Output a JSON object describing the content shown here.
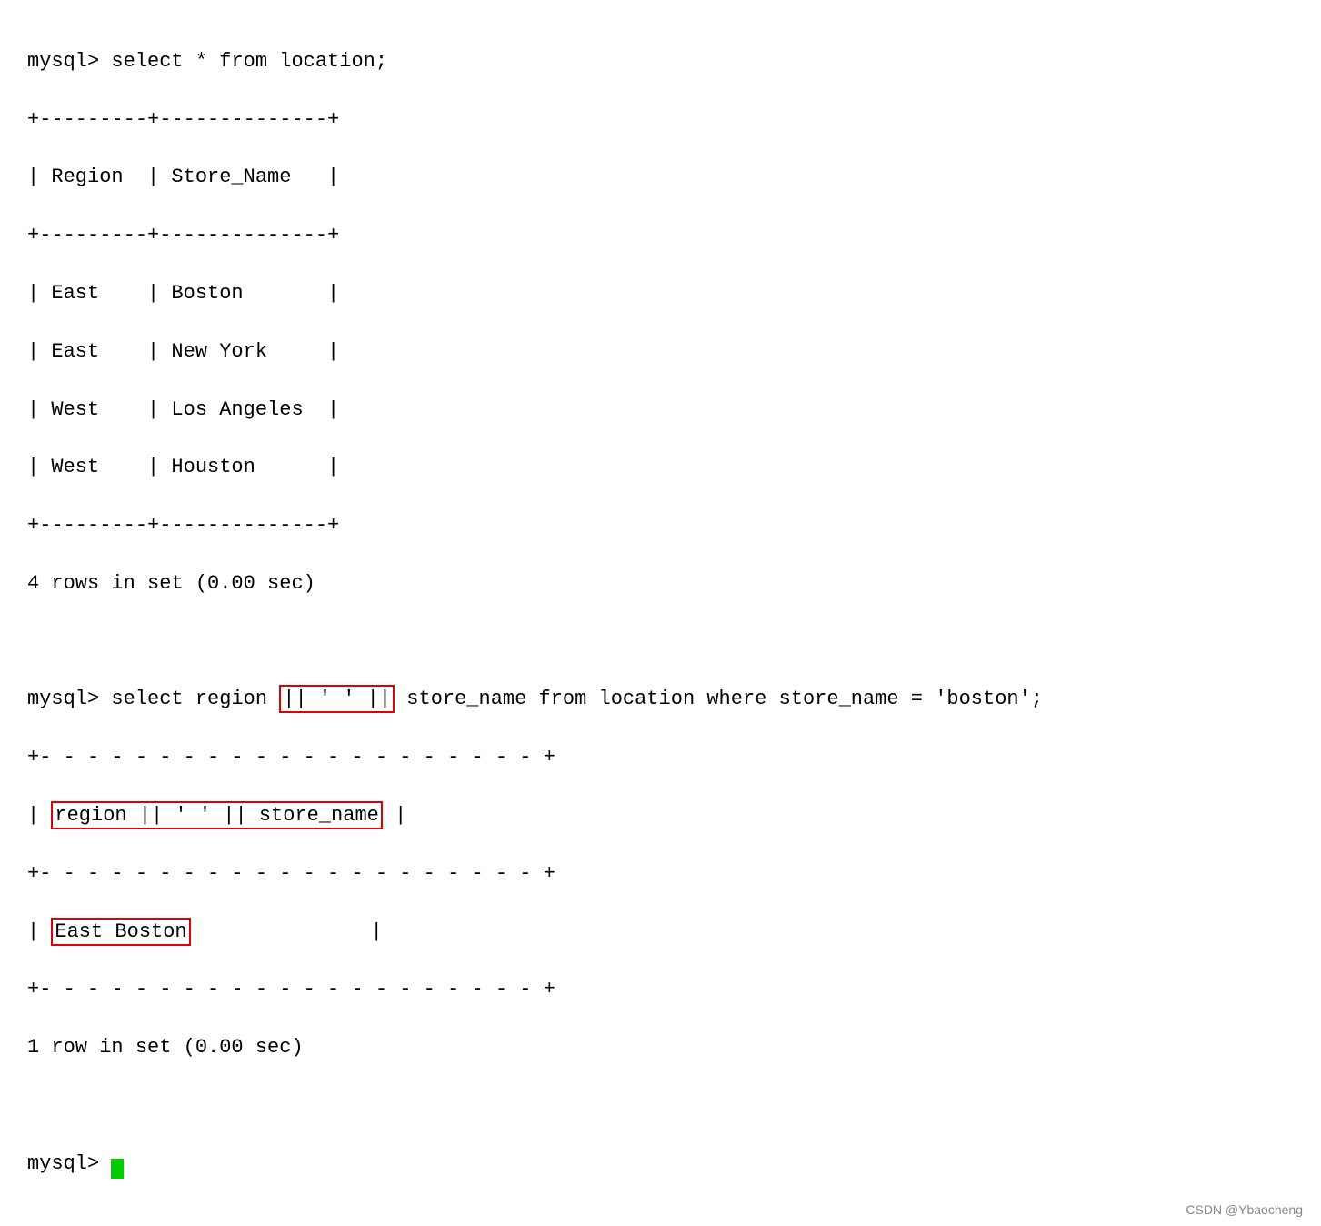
{
  "terminal": {
    "prompt": "mysql>",
    "query1": "select * from location;",
    "table1": {
      "border_top": "+---------+--------------+",
      "header": "| Region  | Store_Name   |",
      "border_mid": "+---------+--------------+",
      "rows": [
        "| East    | Boston       |",
        "| East    | New York     |",
        "| West    | Los Angeles  |",
        "| West    | Houston      |"
      ],
      "border_bot": "+---------+--------------+"
    },
    "result1": "4 rows in set (0.00 sec)",
    "query2_prefix": "select region",
    "query2_highlighted": " || ' ' ||",
    "query2_suffix": " store_name from location where store_name = 'boston';",
    "table2": {
      "border_top": "+--------------------------+",
      "header_prefix": "| ",
      "header_highlighted": "region || ' ' || store_name",
      "header_suffix": " |",
      "border_mid": "+--------------------------+",
      "row_prefix": "| ",
      "row_highlighted": "East Boston",
      "row_suffix": "               |",
      "border_bot": "+--------------------------+"
    },
    "result2": "1 row in set (0.00 sec)",
    "prompt_final": "mysql> "
  },
  "branding": {
    "text": "CSDN @Ybaocheng"
  }
}
